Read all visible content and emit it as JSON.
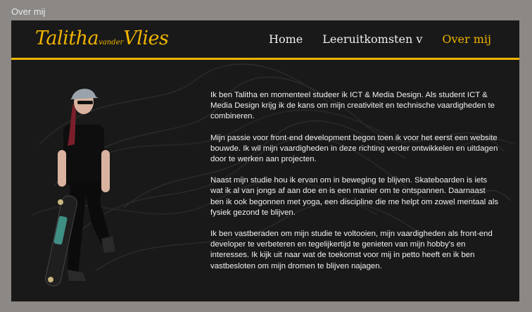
{
  "window": {
    "title": "Over mij"
  },
  "site": {
    "logo": {
      "first": "Talitha",
      "middle": "vander",
      "last": "Vlies"
    },
    "nav": [
      {
        "label": "Home"
      },
      {
        "label": "Leeruitkomsten v"
      },
      {
        "label": "Over mij"
      }
    ],
    "accent": "#f0b400",
    "background": "#191919"
  },
  "about": {
    "paragraphs": [
      "Ik ben Talitha en momenteel studeer ik ICT & Media Design. Als student ICT & Media Design krijg ik de kans om mijn  creativiteit en technische vaardigheden te combineren.",
      "Mijn passie voor front-end development begon toen ik voor het eerst een website bouwde. Ik wil mijn vaardigheden in deze richting verder ontwikkelen en uitdagen door te werken aan projecten.",
      "Naast mijn studie hou ik ervan om in beweging te blijven. Skateboarden is iets wat ik al van jongs af aan doe en is een manier om te ontspannen. Daarnaast ben ik ook begonnen met yoga, een discipline die me helpt om zowel mentaal als fysiek gezond te blijven.",
      "Ik ben vastberaden om mijn studie te voltooien, mijn vaardigheden als front-end developer te verbeteren en tegelijkertijd te genieten van mijn hobby's en interesses. Ik kijk uit naar wat de toekomst voor mij in petto heeft en ik ben vastbesloten om mijn dromen te blijven najagen."
    ]
  }
}
